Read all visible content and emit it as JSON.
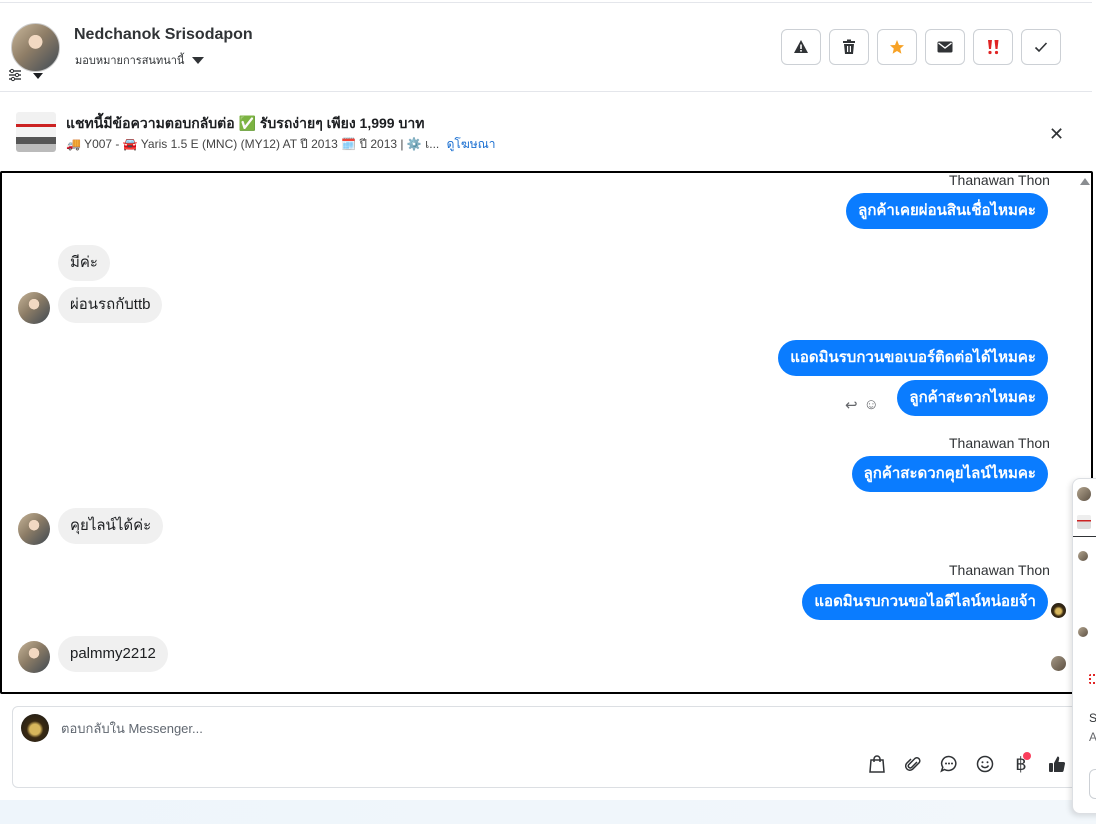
{
  "header": {
    "contact_name": "Nedchanok Srisodapon",
    "assign_label": "มอบหมายการสนทนานี้",
    "actions": [
      {
        "name": "report-spam-button",
        "icon": "warning-icon"
      },
      {
        "name": "delete-button",
        "icon": "trash-icon"
      },
      {
        "name": "star-button",
        "icon": "star-icon",
        "color": "#f7a226"
      },
      {
        "name": "mark-unread-button",
        "icon": "mail-icon"
      },
      {
        "name": "follow-up-button",
        "icon": "double-exclamation-icon",
        "color": "#e02424"
      },
      {
        "name": "mark-done-button",
        "icon": "check-icon"
      }
    ]
  },
  "ad": {
    "title": "แชทนี้มีข้อความตอบกลับต่อ ✅ รับรถง่ายๆ เพียง 1,999 บาท",
    "subtitle": "🚚 Y007 - 🚘 Yaris 1.5 E (MNC) (MY12) AT ปี 2013 🗓️ ปี 2013 | ⚙️ เ...",
    "view_ad_link": "ดูโฆษณา"
  },
  "messages": {
    "m1": {
      "sender": "Thanawan Thon",
      "text": "ลูกค้าเคยผ่อนสินเชื่อไหมคะ"
    },
    "m2": {
      "text": "มีค่ะ"
    },
    "m3": {
      "text": "ผ่อนรถกับttb"
    },
    "m4": {
      "text": "แอดมินรบกวนขอเบอร์ติดต่อได้ไหมคะ"
    },
    "m5": {
      "text": "ลูกค้าสะดวกไหมคะ"
    },
    "m6": {
      "sender": "Thanawan Thon",
      "text": "ลูกค้าสะดวกคุยไลน์ไหมคะ"
    },
    "m7": {
      "text": "คุยไลน์ได้ค่ะ"
    },
    "m8": {
      "sender": "Thanawan Thon",
      "text": "แอดมินรบกวนขอไอดีไลน์หน่อยจ้า"
    },
    "m9": {
      "text": "palmmy2212"
    }
  },
  "composer": {
    "placeholder": "ตอบกลับใน Messenger...",
    "baht_symbol": "฿"
  },
  "side_panel": {
    "letter_s": "S",
    "letter_a": "A"
  },
  "colors": {
    "outgoing_bubble": "#0a7cff",
    "incoming_bubble": "#f0f0f0",
    "link": "#1a6fd1"
  }
}
